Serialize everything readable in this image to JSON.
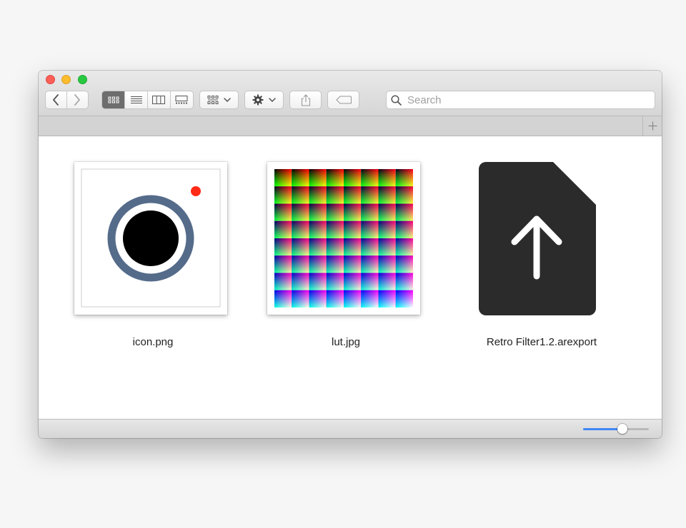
{
  "window": {
    "title": ""
  },
  "toolbar": {
    "back_icon": "chevron-left-icon",
    "forward_icon": "chevron-right-icon",
    "view_modes": [
      {
        "icon": "icon-view-icon",
        "active": true
      },
      {
        "icon": "list-view-icon",
        "active": false
      },
      {
        "icon": "column-view-icon",
        "active": false
      },
      {
        "icon": "gallery-view-icon",
        "active": false
      }
    ],
    "group_icon": "group-by-icon",
    "action_icon": "gear-icon",
    "share_icon": "share-icon",
    "tag_icon": "tag-icon"
  },
  "search": {
    "placeholder": "Search",
    "value": ""
  },
  "files": [
    {
      "name": "icon.png",
      "kind": "image-thumbnail"
    },
    {
      "name": "lut.jpg",
      "kind": "image-thumbnail"
    },
    {
      "name": "Retro Filter1.2.arexport",
      "kind": "document-icon"
    }
  ],
  "icon_size_slider": {
    "value": 0.6
  },
  "colors": {
    "close": "#fc5f57",
    "minimize": "#fdbc2e",
    "zoom": "#28c840",
    "accent": "#3f87f5",
    "camera_ring": "#556b8a",
    "record_dot": "#ff2a16",
    "document_fill": "#2b2b2b"
  }
}
